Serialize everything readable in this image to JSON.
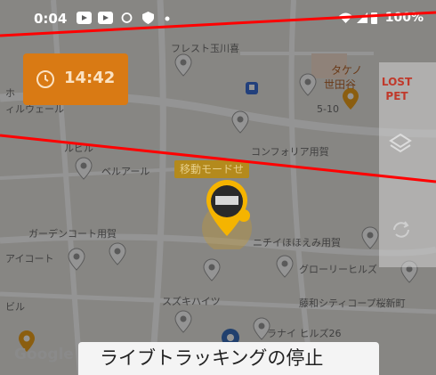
{
  "status_bar": {
    "time": "0:04",
    "icons": [
      "youtube-icon",
      "youtube-icon",
      "sync-icon",
      "shield-icon",
      "dot-icon"
    ],
    "right_text": "100%",
    "right_icons": [
      "wifi-icon",
      "signal-icon",
      "battery-icon"
    ]
  },
  "timer": {
    "icon": "clock-icon",
    "value": "14:42",
    "color": "#d97a14"
  },
  "side_buttons": {
    "lost_pet": {
      "line1": "LOST",
      "line2": "PET",
      "color": "#c0392b"
    },
    "layers_icon": "layers-icon",
    "refresh_icon": "refresh-icon"
  },
  "map": {
    "places": [
      "フレスト玉川喜",
      "ホ",
      "ィルウェール",
      "5-10",
      "コンフォリア用賀",
      "ベルアール",
      "ガーデンコート用賀",
      "アイコート",
      "ニチイほほえみ用賀",
      "グローリーヒルズ",
      "スズキハイツ",
      "藤和シティコープ桜新町",
      "ラナイ ヒルズ26",
      "タケノ",
      "世田谷",
      "ビル",
      "ルビル"
    ],
    "mode_badge": "移動モードせ",
    "attribution": "Google"
  },
  "sheet": {
    "title": "ライブトラッキングの停止"
  },
  "colors": {
    "annotation_line": "#ff0000",
    "pin": "#ffffff",
    "marker": "#f5b400"
  }
}
